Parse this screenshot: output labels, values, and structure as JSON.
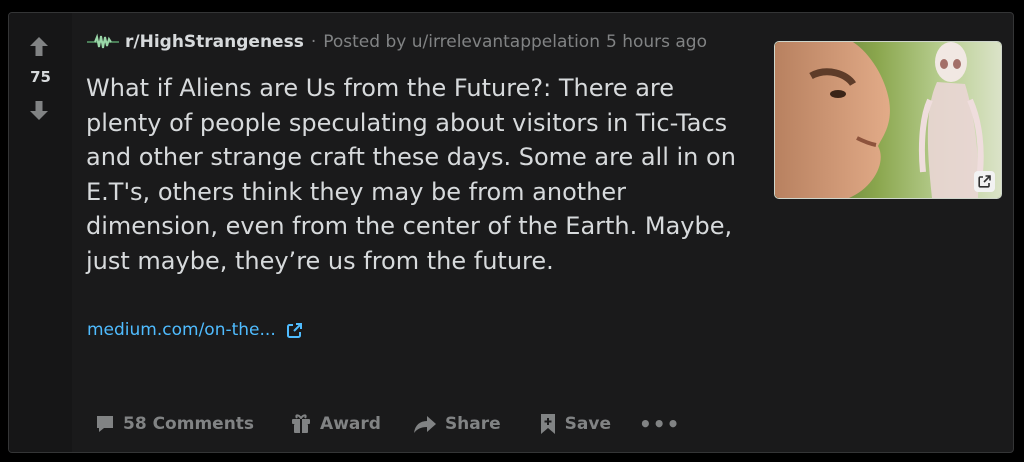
{
  "post": {
    "score": "75",
    "subreddit": "r/HighStrangeness",
    "separator": "·",
    "posted_by": "Posted by u/irrelevantappelation",
    "time": "5 hours ago",
    "title": "What if Aliens are Us from the Future?: There are plenty of people speculating about visitors in Tic-Tacs and other strange craft these days. Some are all in on E.T's, others think they may be from another dimension, even from the center of the Earth. Maybe, just maybe, they’re us from the future.",
    "link_text": "medium.com/on-the...",
    "thumbnail_icon": "external-link-icon"
  },
  "actions": {
    "comments_label": "58 Comments",
    "award_label": "Award",
    "share_label": "Share",
    "save_label": "Save",
    "more_label": "•••"
  },
  "colors": {
    "background": "#1a1a1b",
    "text": "#d7dadc",
    "muted": "#818384",
    "link": "#4fbcff"
  },
  "icons": [
    "upvote-icon",
    "downvote-icon",
    "subreddit-icon",
    "external-link-icon",
    "comment-icon",
    "award-icon",
    "share-icon",
    "save-icon"
  ]
}
